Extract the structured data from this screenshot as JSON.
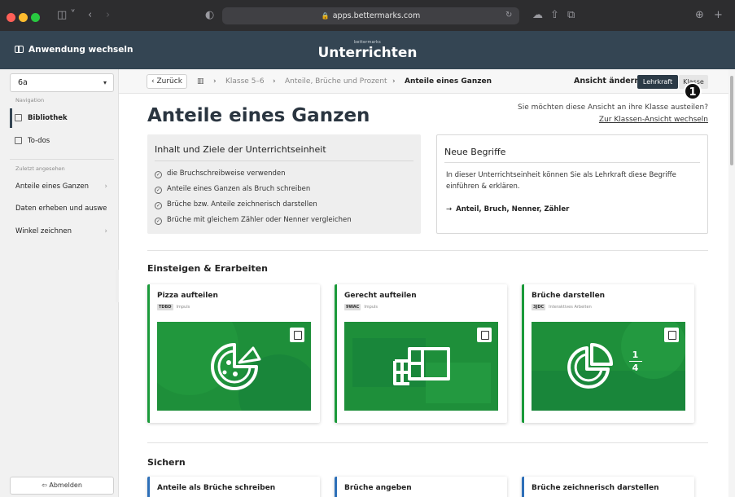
{
  "browser": {
    "url": "apps.bettermarks.com"
  },
  "header": {
    "switch_app": "Anwendung wechseln",
    "brand_small": "bettermarks",
    "brand_title": "Unterrichten"
  },
  "sidebar": {
    "class_value": "6a",
    "nav_label": "Navigation",
    "nav_items": [
      {
        "label": "Bibliothek"
      },
      {
        "label": "To-dos"
      }
    ],
    "recent_label": "Zuletzt angesehen",
    "recent_items": [
      {
        "label": "Anteile eines Ganzen"
      },
      {
        "label": "Daten erheben und auswe..."
      },
      {
        "label": "Winkel zeichnen"
      }
    ],
    "logout": "Abmelden"
  },
  "breadcrumb": {
    "back": "Zurück",
    "items": [
      "Klasse 5–6",
      "Anteile, Brüche und Prozent",
      "Anteile eines Ganzen"
    ]
  },
  "view_toggle": {
    "label": "Ansicht ändern",
    "teacher": "Lehrkraft",
    "class": "Klasse",
    "badge": "1"
  },
  "page": {
    "title": "Anteile eines Ganzen",
    "switch_question": "Sie möchten diese Ansicht an ihre Klasse austeilen?",
    "switch_link": "Zur Klassen-Ansicht wechseln"
  },
  "goals": {
    "title": "Inhalt und Ziele der Unterrichtseinheit",
    "items": [
      "die Bruchschreibweise verwenden",
      "Anteile eines Ganzen als Bruch schreiben",
      "Brüche bzw. Anteile zeichnerisch darstellen",
      "Brüche mit gleichem Zähler oder Nenner vergleichen"
    ]
  },
  "terms": {
    "title": "Neue Begriffe",
    "description": "In dieser Unterrichtseinheit können Sie als Lehrkraft diese Begriffe einführen & erklären.",
    "list": "Anteil, Bruch, Nenner, Zähler"
  },
  "section1": {
    "title": "Einsteigen & Erarbeiten",
    "cards": [
      {
        "title": "Pizza aufteilen",
        "code": "TDBD",
        "type": "Impuls",
        "icon": "pizza-icon"
      },
      {
        "title": "Gerecht aufteilen",
        "code": "9WAC",
        "type": "Impuls",
        "icon": "chocolate-icon"
      },
      {
        "title": "Brüche darstellen",
        "code": "3JDC",
        "type": "Interaktives Arbeiten",
        "icon": "pie-chart-icon",
        "fraction_num": "1",
        "fraction_den": "4"
      }
    ]
  },
  "section2": {
    "title": "Sichern",
    "cards": [
      {
        "title": "Anteile als Brüche schreiben"
      },
      {
        "title": "Brüche angeben"
      },
      {
        "title": "Brüche zeichnerisch darstellen"
      }
    ]
  },
  "colors": {
    "header_bg": "#344553",
    "accent_green": "#1a9a3a",
    "accent_blue": "#2d6fb8"
  }
}
